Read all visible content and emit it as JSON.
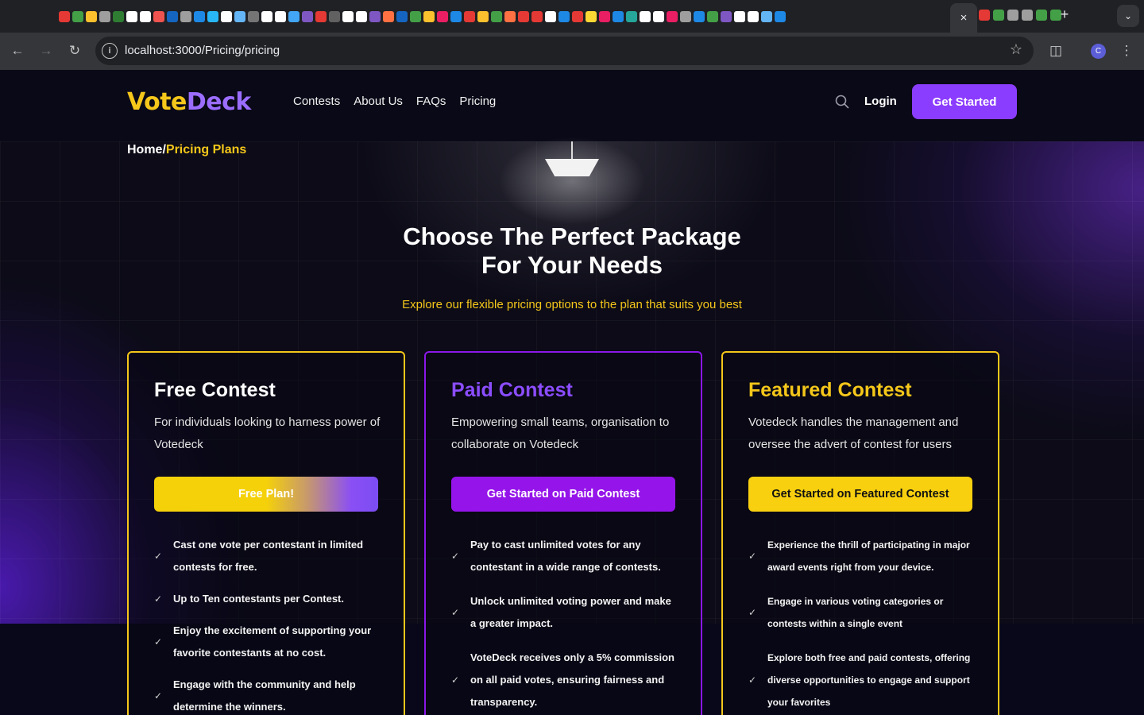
{
  "browser": {
    "url": "localhost:3000/Pricing/pricing",
    "tab_close": "×",
    "new_tab": "+",
    "profile_initial": "C",
    "favicons": [
      "#e53935",
      "#43a047",
      "#fbc02d",
      "#9e9e9e",
      "#2e7d32",
      "#ffffff",
      "#ffffff",
      "#ef5350",
      "#1565c0",
      "#9e9e9e",
      "#1e88e5",
      "#29b6f6",
      "#ffffff",
      "#64b5f6",
      "#757575",
      "#ffffff",
      "#ffffff",
      "#42a5f5",
      "#7e57c2",
      "#e53935",
      "#616161",
      "#ffffff",
      "#ffffff",
      "#7e57c2",
      "#ff7043",
      "#1565c0",
      "#43a047",
      "#fbc02d",
      "#e91e63",
      "#1e88e5",
      "#e53935",
      "#fbc02d",
      "#43a047",
      "#ff7043",
      "#e53935",
      "#e53935",
      "#ffffff",
      "#1e88e5",
      "#e53935",
      "#fdd835",
      "#e91e63",
      "#1e88e5",
      "#26a69a",
      "#ffffff",
      "#ffffff",
      "#e91e63",
      "#9e9e9e",
      "#1e88e5",
      "#43a047",
      "#7e57c2",
      "#ffffff",
      "#ffffff",
      "#64b5f6",
      "#1e88e5"
    ],
    "favicons_right": [
      "#e53935",
      "#43a047",
      "#9e9e9e",
      "#9e9e9e",
      "#43a047",
      "#43a047"
    ]
  },
  "site": {
    "logo_part1": "Vote",
    "logo_part2": "Deck",
    "nav": [
      "Contests",
      "About Us",
      "FAQs",
      "Pricing"
    ],
    "login": "Login",
    "get_started": "Get Started",
    "breadcrumb_home": "Home",
    "breadcrumb_sep": "/",
    "breadcrumb_current": "Pricing Plans"
  },
  "hero": {
    "title_line1": "Choose The Perfect Package",
    "title_line2": "For Your Needs",
    "subtitle": "Explore our flexible pricing options to the plan that suits you best"
  },
  "plans": [
    {
      "title": "Free Contest",
      "title_color": "#ffffff",
      "description": "For individuals looking to harness power of Votedeck",
      "button": "Free Plan!",
      "features": [
        "Cast one vote per contestant in limited contests for free.",
        "Up to Ten contestants per Contest.",
        "Enjoy the excitement of supporting your favorite contestants at no cost.",
        "Engage with the community and help determine the winners."
      ]
    },
    {
      "title": "Paid Contest",
      "title_color": "#8b4dff",
      "description": "Empowering small teams, organisation to collaborate on Votedeck",
      "button": "Get Started on Paid Contest",
      "features": [
        "Pay to cast unlimited votes for any contestant in a wide range of contests.",
        "Unlock unlimited voting power and make a greater impact.",
        "VoteDeck receives only a 5% commission on all paid votes, ensuring fairness and transparency."
      ]
    },
    {
      "title": "Featured Contest",
      "title_color": "#f5c71a",
      "description": "Votedeck handles the management and oversee the advert of contest for users",
      "button": "Get Started on Featured Contest",
      "features": [
        "Experience the thrill of participating in major award events right from your device.",
        "Engage in various voting categories or contests within a single event",
        "Explore both free and paid contests, offering diverse opportunities to engage and support your favorites"
      ]
    }
  ]
}
